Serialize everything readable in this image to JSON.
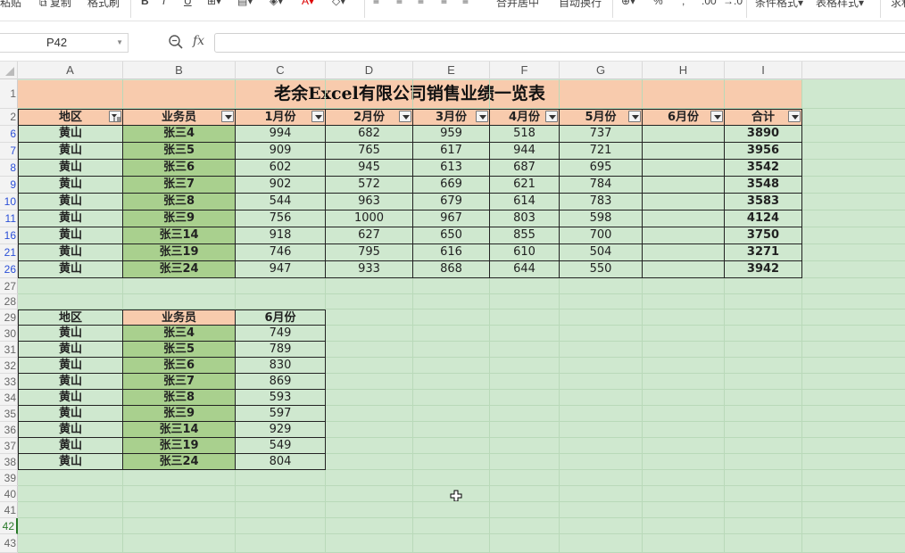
{
  "ribbon": {
    "items": [
      "粘贴",
      "复制",
      "格式刷",
      "B",
      "I",
      "U",
      "合并居中",
      "自动换行",
      "%",
      ".00",
      "条件格式",
      "表格样式",
      "求和"
    ]
  },
  "formula_bar": {
    "cell_ref": "P42",
    "fx_label": "fx",
    "formula": ""
  },
  "columns": [
    "A",
    "B",
    "C",
    "D",
    "E",
    "F",
    "G",
    "H",
    "I"
  ],
  "rows": [
    "1",
    "2",
    "6",
    "7",
    "8",
    "9",
    "10",
    "11",
    "16",
    "21",
    "26",
    "27",
    "28",
    "29",
    "30",
    "31",
    "32",
    "33",
    "34",
    "35",
    "36",
    "37",
    "38",
    "39",
    "40",
    "41",
    "42",
    "43"
  ],
  "table1": {
    "title": "老余Excel有限公司销售业绩一览表",
    "headers": [
      "地区",
      "业务员",
      "1月份",
      "2月份",
      "3月份",
      "4月份",
      "5月份",
      "6月份",
      "合计"
    ],
    "rows": [
      [
        "黄山",
        "张三4",
        "994",
        "682",
        "959",
        "518",
        "737",
        "",
        "3890"
      ],
      [
        "黄山",
        "张三5",
        "909",
        "765",
        "617",
        "944",
        "721",
        "",
        "3956"
      ],
      [
        "黄山",
        "张三6",
        "602",
        "945",
        "613",
        "687",
        "695",
        "",
        "3542"
      ],
      [
        "黄山",
        "张三7",
        "902",
        "572",
        "669",
        "621",
        "784",
        "",
        "3548"
      ],
      [
        "黄山",
        "张三8",
        "544",
        "963",
        "679",
        "614",
        "783",
        "",
        "3583"
      ],
      [
        "黄山",
        "张三9",
        "756",
        "1000",
        "967",
        "803",
        "598",
        "",
        "4124"
      ],
      [
        "黄山",
        "张三14",
        "918",
        "627",
        "650",
        "855",
        "700",
        "",
        "3750"
      ],
      [
        "黄山",
        "张三19",
        "746",
        "795",
        "616",
        "610",
        "504",
        "",
        "3271"
      ],
      [
        "黄山",
        "张三24",
        "947",
        "933",
        "868",
        "644",
        "550",
        "",
        "3942"
      ]
    ]
  },
  "table2": {
    "headers": [
      "地区",
      "业务员",
      "6月份"
    ],
    "rows": [
      [
        "黄山",
        "张三4",
        "749"
      ],
      [
        "黄山",
        "张三5",
        "789"
      ],
      [
        "黄山",
        "张三6",
        "830"
      ],
      [
        "黄山",
        "张三7",
        "869"
      ],
      [
        "黄山",
        "张三8",
        "593"
      ],
      [
        "黄山",
        "张三9",
        "597"
      ],
      [
        "黄山",
        "张三14",
        "929"
      ],
      [
        "黄山",
        "张三19",
        "549"
      ],
      [
        "黄山",
        "张三24",
        "804"
      ]
    ]
  },
  "colors": {
    "sheet_background": "#cfe8cf",
    "header_fill": "#f8cbad",
    "name_column_fill": "#a9d08e",
    "filtered_row_number": "#2b4fd7",
    "active_row_number": "#2a7a2a"
  }
}
